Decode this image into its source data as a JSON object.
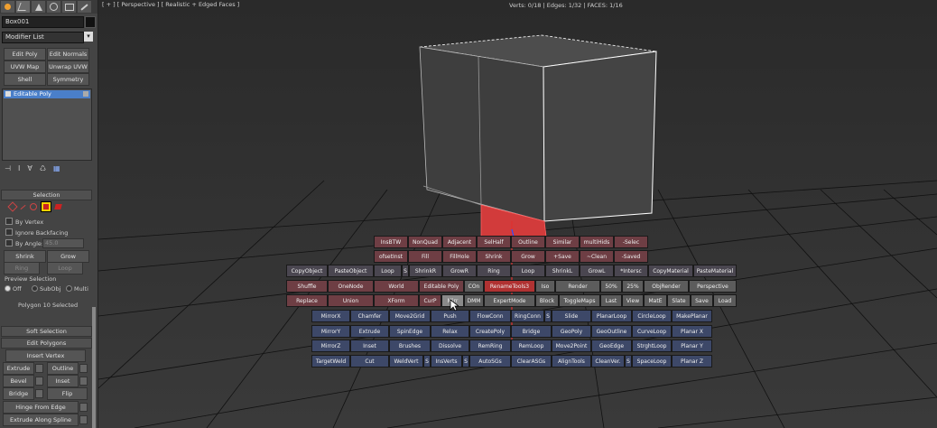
{
  "command_panel": {
    "tabs": [
      "create-icon",
      "modify-icon",
      "hierarchy-icon",
      "motion-icon",
      "display-icon",
      "utilities-icon"
    ],
    "object_name": "Box001",
    "modifier_list": "Modifier List",
    "modifier_buttons": [
      "Edit Poly",
      "Edit Normals",
      "UVW Map",
      "Unwrap UVW",
      "Shell",
      "Symmetry"
    ],
    "stack": {
      "selected": "Editable Poly"
    },
    "selection": {
      "title": "Selection",
      "by_vertex": "By Vertex",
      "ignore_backfacing": "Ignore Backfacing",
      "by_angle": "By Angle:",
      "angle_value": "45.0",
      "shrink": "Shrink",
      "grow": "Grow",
      "ring": "Ring",
      "loop": "Loop",
      "preview_label": "Preview Selection",
      "preview_off": "Off",
      "preview_subobj": "SubObj",
      "preview_multi": "Multi",
      "status": "Polygon 10 Selected"
    },
    "soft_selection": "Soft Selection",
    "edit_polygons": {
      "title": "Edit Polygons",
      "insert_vertex": "Insert Vertex",
      "extrude": "Extrude",
      "outline": "Outline",
      "bevel": "Bevel",
      "inset": "Inset",
      "bridge": "Bridge",
      "flip": "Flip",
      "hinge": "Hinge From Edge",
      "extrude_spline": "Extrude Along Spline"
    }
  },
  "viewport": {
    "label": "[ + ] [ Perspective ] [ Realistic + Edged Faces ]",
    "stats": "Verts: 0/18 | Edges: 1/32 | FACES: 1/16"
  },
  "quad_menu": {
    "row1": [
      "InsBTW",
      "NonQuad",
      "Adjacent",
      "SelHalf",
      "Outline",
      "Similar",
      "multiHids",
      "-Selec"
    ],
    "row2": [
      "ofsetInst",
      "Fill",
      "FillHole",
      "Shrink",
      "Grow",
      "+Save",
      "~Clean",
      "-Saved"
    ],
    "row3": [
      "CopyObject",
      "PasteObject",
      "Loop",
      "S",
      "ShrinkR",
      "GrowR",
      "Ring",
      "Loop",
      "ShrinkL",
      "GrowL",
      "*Intersc",
      "CopyMaterial",
      "PasteMaterial"
    ],
    "row4": [
      "Shuffle",
      "OneNode",
      "World",
      "Editable Poly",
      "COn",
      "RenameTools3",
      "Iso",
      "Render",
      "50%",
      "25%",
      "ObjRender",
      "Perspective"
    ],
    "row5": [
      "Replace",
      "Union",
      "XForm",
      "CurP",
      "Mirr",
      "DMM",
      "ExpertMode",
      "Block",
      "ToggleMaps",
      "Last",
      "View",
      "MatE",
      "Slate",
      "Save",
      "Load"
    ],
    "row6": [
      "MirrorX",
      "Chamfer",
      "Move2Grid",
      "Push",
      "FlowConn",
      "RingConn",
      "S",
      "Slide",
      "PlanarLoop",
      "CircleLoop",
      "MakePlanar"
    ],
    "row7": [
      "MirrorY",
      "Extrude",
      "SpinEdge",
      "Relax",
      "CreatePoly",
      "Bridge",
      "GeoPoly",
      "GeoOutline",
      "CurveLoop",
      "Planar X"
    ],
    "row8": [
      "MirrorZ",
      "Inset",
      "Brushes",
      "Dissolve",
      "RemRing",
      "RemLoop",
      "Move2Point",
      "GeoEdge",
      "StrghtLoop",
      "Planar Y"
    ],
    "row9": [
      "TargetWeld",
      "Cut",
      "WeldVert",
      "S",
      "InsVerts",
      "S",
      "AutoSGs",
      "ClearASGs",
      "AlignTools",
      "CleanVer.",
      "S",
      "SpaceLoop",
      "Planar Z"
    ]
  },
  "colors": {
    "viewport_bg": "#2b2b2b",
    "selected_face": "#d23b3b",
    "quad_pink": "#6e3e44",
    "quad_blue": "#3d4868",
    "stack_highlight": "#4a7fc9"
  }
}
